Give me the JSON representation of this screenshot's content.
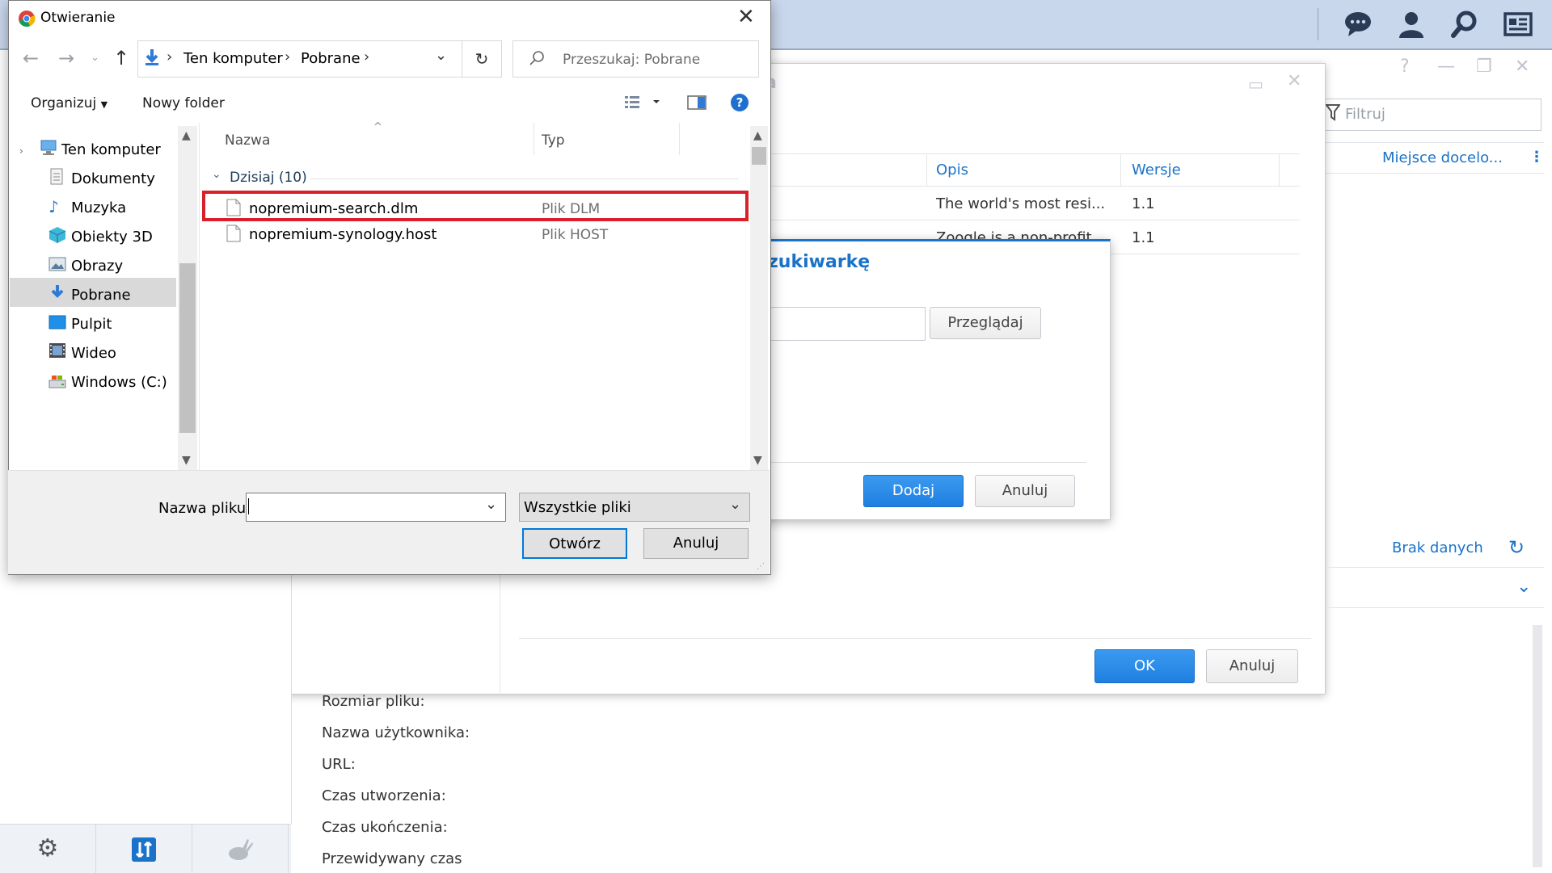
{
  "background_app": {
    "window_title_partial": "wienia",
    "filter_placeholder": "Filtruj",
    "destination_link": "Miejsce docelo...",
    "table": {
      "headers": [
        "Opis",
        "Wersje"
      ],
      "rows": [
        {
          "opis": "The world's most resi...",
          "wersje": "1.1"
        },
        {
          "opis": "Zoogle is a non-profit...",
          "wersje": "1.1"
        }
      ]
    },
    "no_data_link": "Brak danych",
    "ok_button": "OK",
    "cancel_button": "Anuluj",
    "details": {
      "file_size": "Rozmiar pliku:",
      "username": "Nazwa użytkownika:",
      "url": "URL:",
      "created": "Czas utworzenia:",
      "completed": "Czas ukończenia:",
      "estimated": "Przewidywany czas"
    }
  },
  "add_search_dialog": {
    "title_partial": "zukiwarkę",
    "browse_button": "Przeglądaj",
    "add_button": "Dodaj",
    "cancel_button": "Anuluj"
  },
  "file_dialog": {
    "title": "Otwieranie",
    "address": {
      "segments": [
        "Ten komputer",
        "Pobrane"
      ]
    },
    "search_placeholder": "Przeszukaj: Pobrane",
    "toolbar": {
      "organize": "Organizuj",
      "new_folder": "Nowy folder"
    },
    "nav_items": [
      {
        "label": "Ten komputer",
        "icon": "computer-icon"
      },
      {
        "label": "Dokumenty",
        "icon": "documents-icon"
      },
      {
        "label": "Muzyka",
        "icon": "music-icon"
      },
      {
        "label": "Obiekty 3D",
        "icon": "3d-objects-icon"
      },
      {
        "label": "Obrazy",
        "icon": "pictures-icon"
      },
      {
        "label": "Pobrane",
        "icon": "downloads-icon"
      },
      {
        "label": "Pulpit",
        "icon": "desktop-icon"
      },
      {
        "label": "Wideo",
        "icon": "video-icon"
      },
      {
        "label": "Windows (C:)",
        "icon": "drive-icon"
      }
    ],
    "columns": {
      "name": "Nazwa",
      "type": "Typ"
    },
    "group_label": "Dzisiaj (10)",
    "files": [
      {
        "name": "nopremium-search.dlm",
        "type": "Plik DLM"
      },
      {
        "name": "nopremium-synology.host",
        "type": "Plik HOST"
      }
    ],
    "filename_label": "Nazwa pliku:",
    "filename_value": "",
    "filetype_value": "Wszystkie pliki",
    "open_button": "Otwórz",
    "cancel_button": "Anuluj"
  },
  "colors": {
    "accent": "#1a73c8",
    "highlight": "#d9202a",
    "topbar": "#c9d7ec"
  }
}
